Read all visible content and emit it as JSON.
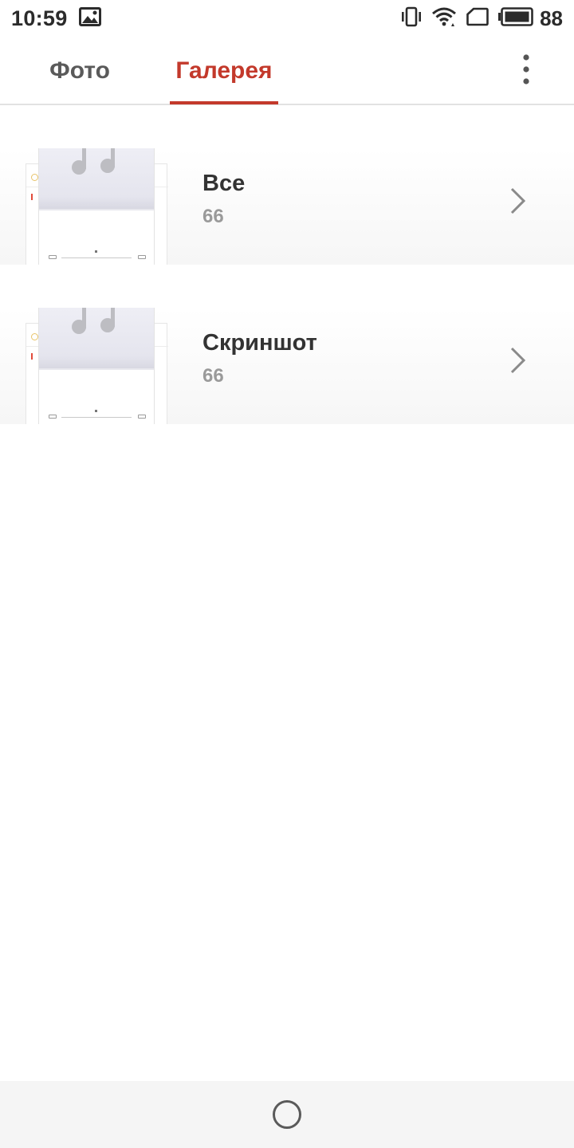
{
  "status_bar": {
    "time": "10:59",
    "battery_level": "88",
    "icons": [
      "image-notification-icon",
      "vibrate-icon",
      "wifi-icon",
      "sim-card-icon",
      "battery-icon"
    ]
  },
  "tabs": [
    {
      "label": "Фото",
      "active": false
    },
    {
      "label": "Галерея",
      "active": true
    }
  ],
  "accent_color": "#c3392b",
  "albums": [
    {
      "name": "Все",
      "count": "66"
    },
    {
      "name": "Скриншот",
      "count": "66"
    }
  ],
  "icons": {
    "more": "more-vertical-icon",
    "row_arrow": "chevron-right-icon",
    "home": "home-circle-icon"
  }
}
